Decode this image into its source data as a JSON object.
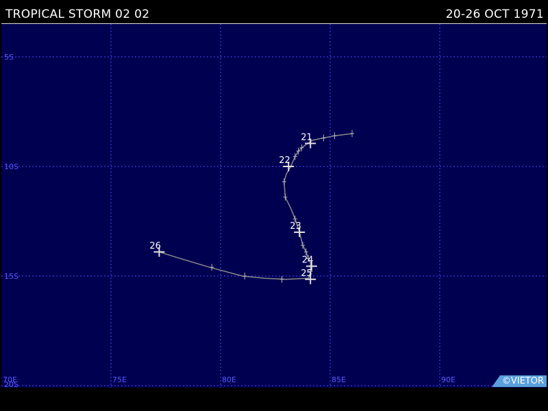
{
  "header": {
    "title": "TROPICAL STORM 02 02",
    "date_range": "20-26 OCT 1971"
  },
  "map": {
    "lon_range": [
      70,
      95
    ],
    "lat_range": [
      -20,
      -3.5
    ],
    "grid": true,
    "colors": {
      "ocean": "#000050",
      "grid": "#4a4aff",
      "track": "#8a8a8a",
      "label": "#ffffff"
    },
    "lon_labels": [
      {
        "value": 70,
        "text": "70E"
      },
      {
        "value": 75,
        "text": "75E"
      },
      {
        "value": 80,
        "text": "80E"
      },
      {
        "value": 85,
        "text": "85E"
      },
      {
        "value": 90,
        "text": "90E"
      }
    ],
    "lat_labels": [
      {
        "value": -5,
        "text": "5S"
      },
      {
        "value": -10,
        "text": "10S"
      },
      {
        "value": -15,
        "text": "15S"
      },
      {
        "value": -20,
        "text": "20S"
      }
    ]
  },
  "track": {
    "points": [
      {
        "lon": 86.0,
        "lat": -8.5
      },
      {
        "lon": 85.6,
        "lat": -8.55
      },
      {
        "lon": 85.2,
        "lat": -8.6
      },
      {
        "lon": 84.7,
        "lat": -8.7
      },
      {
        "lon": 84.2,
        "lat": -8.8
      },
      {
        "lon": 83.9,
        "lat": -9.0
      },
      {
        "lon": 83.7,
        "lat": -9.15
      },
      {
        "lon": 83.55,
        "lat": -9.3
      },
      {
        "lon": 83.4,
        "lat": -9.55
      },
      {
        "lon": 83.2,
        "lat": -10.0
      },
      {
        "lon": 83.0,
        "lat": -10.35
      },
      {
        "lon": 82.9,
        "lat": -10.7
      },
      {
        "lon": 82.95,
        "lat": -11.4
      },
      {
        "lon": 83.2,
        "lat": -11.9
      },
      {
        "lon": 83.4,
        "lat": -12.4
      },
      {
        "lon": 83.6,
        "lat": -13.0
      },
      {
        "lon": 83.75,
        "lat": -13.6
      },
      {
        "lon": 83.9,
        "lat": -13.9
      },
      {
        "lon": 84.0,
        "lat": -14.2
      },
      {
        "lon": 84.1,
        "lat": -14.4
      },
      {
        "lon": 84.1,
        "lat": -14.6
      },
      {
        "lon": 84.1,
        "lat": -14.8
      },
      {
        "lon": 84.05,
        "lat": -15.0
      },
      {
        "lon": 84.0,
        "lat": -15.1
      },
      {
        "lon": 83.0,
        "lat": -15.15
      },
      {
        "lon": 82.0,
        "lat": -15.1
      },
      {
        "lon": 81.0,
        "lat": -15.0
      },
      {
        "lon": 79.5,
        "lat": -14.6
      },
      {
        "lon": 78.0,
        "lat": -14.15
      },
      {
        "lon": 77.2,
        "lat": -13.9
      }
    ],
    "ticks": [
      {
        "lon": 86.0,
        "lat": -8.5
      },
      {
        "lon": 85.2,
        "lat": -8.6
      },
      {
        "lon": 84.7,
        "lat": -8.7
      },
      {
        "lon": 83.7,
        "lat": -9.15
      },
      {
        "lon": 83.55,
        "lat": -9.3
      },
      {
        "lon": 83.4,
        "lat": -9.55
      },
      {
        "lon": 82.9,
        "lat": -10.7
      },
      {
        "lon": 82.95,
        "lat": -11.4
      },
      {
        "lon": 83.4,
        "lat": -12.4
      },
      {
        "lon": 83.75,
        "lat": -13.6
      },
      {
        "lon": 83.9,
        "lat": -13.9
      },
      {
        "lon": 84.0,
        "lat": -14.2
      },
      {
        "lon": 84.1,
        "lat": -14.8
      },
      {
        "lon": 82.8,
        "lat": -15.15
      },
      {
        "lon": 81.1,
        "lat": -15.0
      },
      {
        "lon": 79.6,
        "lat": -14.6
      }
    ],
    "day_markers": [
      {
        "lon": 84.1,
        "lat": -8.95,
        "text": "21"
      },
      {
        "lon": 83.1,
        "lat": -10.0,
        "text": "22"
      },
      {
        "lon": 83.6,
        "lat": -13.0,
        "text": "23"
      },
      {
        "lon": 84.15,
        "lat": -14.55,
        "text": "24"
      },
      {
        "lon": 84.1,
        "lat": -15.15,
        "text": "25"
      },
      {
        "lon": 77.2,
        "lat": -13.9,
        "text": "26"
      }
    ]
  },
  "copyright": "©VIETOR"
}
